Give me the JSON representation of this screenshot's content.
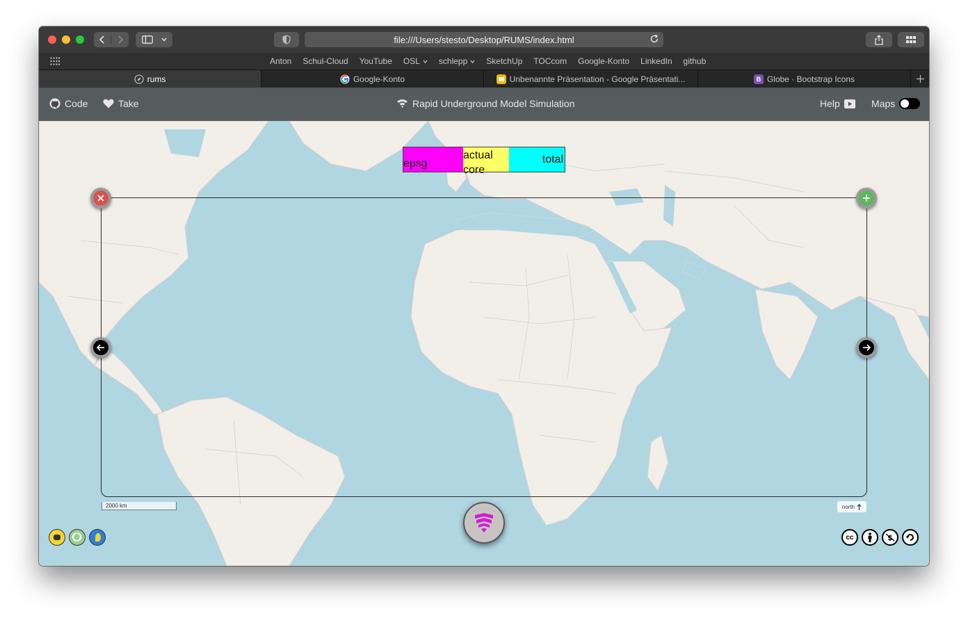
{
  "browser": {
    "url": "file:///Users/stesto/Desktop/RUMS/index.html",
    "bookmarks": [
      "Anton",
      "Schul-Cloud",
      "YouTube",
      "OSL",
      "schlepp",
      "SketchUp",
      "TOCcom",
      "Google-Konto",
      "LinkedIn",
      "github"
    ],
    "tabs": [
      {
        "label": "rums",
        "active": true
      },
      {
        "label": "Google-Konto",
        "active": false
      },
      {
        "label": "Unbenannte Präsentation - Google Präsentati...",
        "active": false
      },
      {
        "label": "Globe · Bootstrap Icons",
        "active": false
      }
    ]
  },
  "app": {
    "nav": {
      "code": "Code",
      "take": "Take",
      "title": "Rapid Underground Model Simulation",
      "help": "Help",
      "maps": "Maps",
      "maps_toggle_on": false
    },
    "legend": {
      "epsg": "epsg",
      "actual_core": "actual core",
      "total": "total",
      "colors": {
        "epsg": "#ff00ff",
        "actual_core": "#ffff66",
        "total": "#00ffff"
      }
    },
    "scale_label": "2000 km",
    "north_label": "north",
    "colors": {
      "accent": "#d020d0",
      "close": "#d9534f",
      "add": "#5cb85c"
    },
    "icons": [
      "github-icon",
      "heart-icon",
      "wifi-stack-icon",
      "play-icon",
      "close-circle-icon",
      "plus-circle-icon",
      "arrow-left-icon",
      "arrow-right-icon",
      "cc-icon",
      "by-icon",
      "nc-icon",
      "sa-icon"
    ]
  }
}
